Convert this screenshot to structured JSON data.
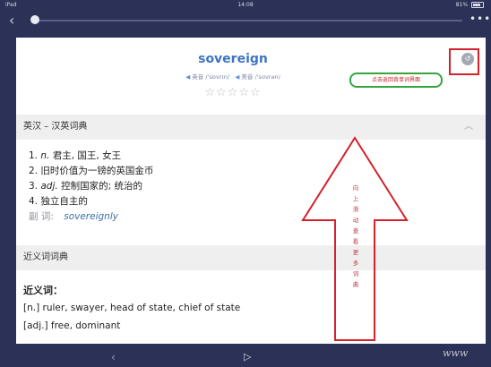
{
  "status_bar": {
    "device": "iPad",
    "time": "14:08",
    "battery": "81%"
  },
  "icons": {
    "back": "chevron-left-icon",
    "more": "more-icon",
    "return": "return-icon",
    "prev": "chevron-left-icon",
    "play": "play-icon"
  },
  "entry": {
    "word": "sovereign",
    "uk_pron": "英音 /'sɒvrɪn/",
    "us_pron": "美音 /'sɑvrən/",
    "rating_stars": 5
  },
  "annotation": {
    "note_pill": "点击返回背单词界面",
    "arrow_text": "向上滑动查看更多词典"
  },
  "dict_section": {
    "title": "英汉 – 汉英词典",
    "definitions": [
      {
        "num": "1.",
        "pos": "n.",
        "text": " 君主, 国王, 女王"
      },
      {
        "num": "2.",
        "pos": "",
        "text": "旧时价值为一镑的英国金币"
      },
      {
        "num": "3.",
        "pos": "adj.",
        "text": " 控制国家的; 统治的"
      },
      {
        "num": "4.",
        "pos": "",
        "text": "独立自主的"
      }
    ],
    "derivative_label": "副 词:",
    "derivative_word": "sovereignly"
  },
  "synonyms_section": {
    "title": "近义词词典",
    "heading": "近义词：",
    "line1": "[n.] ruler, swayer, head of state, chief of state",
    "line2": "[adj.] free, dominant"
  },
  "watermark": "www"
}
